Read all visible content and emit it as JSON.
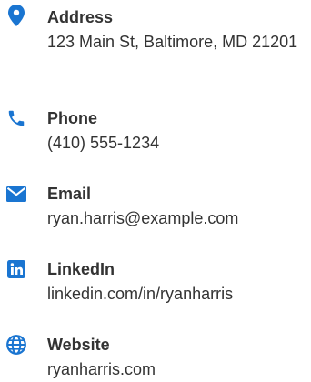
{
  "accent_color": "#1a75d1",
  "contacts": [
    {
      "icon": "map-pin-icon",
      "label": "Address",
      "value": "123 Main St, Baltimore, MD 21201"
    },
    {
      "icon": "phone-icon",
      "label": "Phone",
      "value": "(410) 555-1234"
    },
    {
      "icon": "envelope-icon",
      "label": "Email",
      "value": "ryan.harris@example.com"
    },
    {
      "icon": "linkedin-icon",
      "label": "LinkedIn",
      "value": "linkedin.com/in/ryanharris"
    },
    {
      "icon": "globe-icon",
      "label": "Website",
      "value": "ryanharris.com"
    }
  ]
}
